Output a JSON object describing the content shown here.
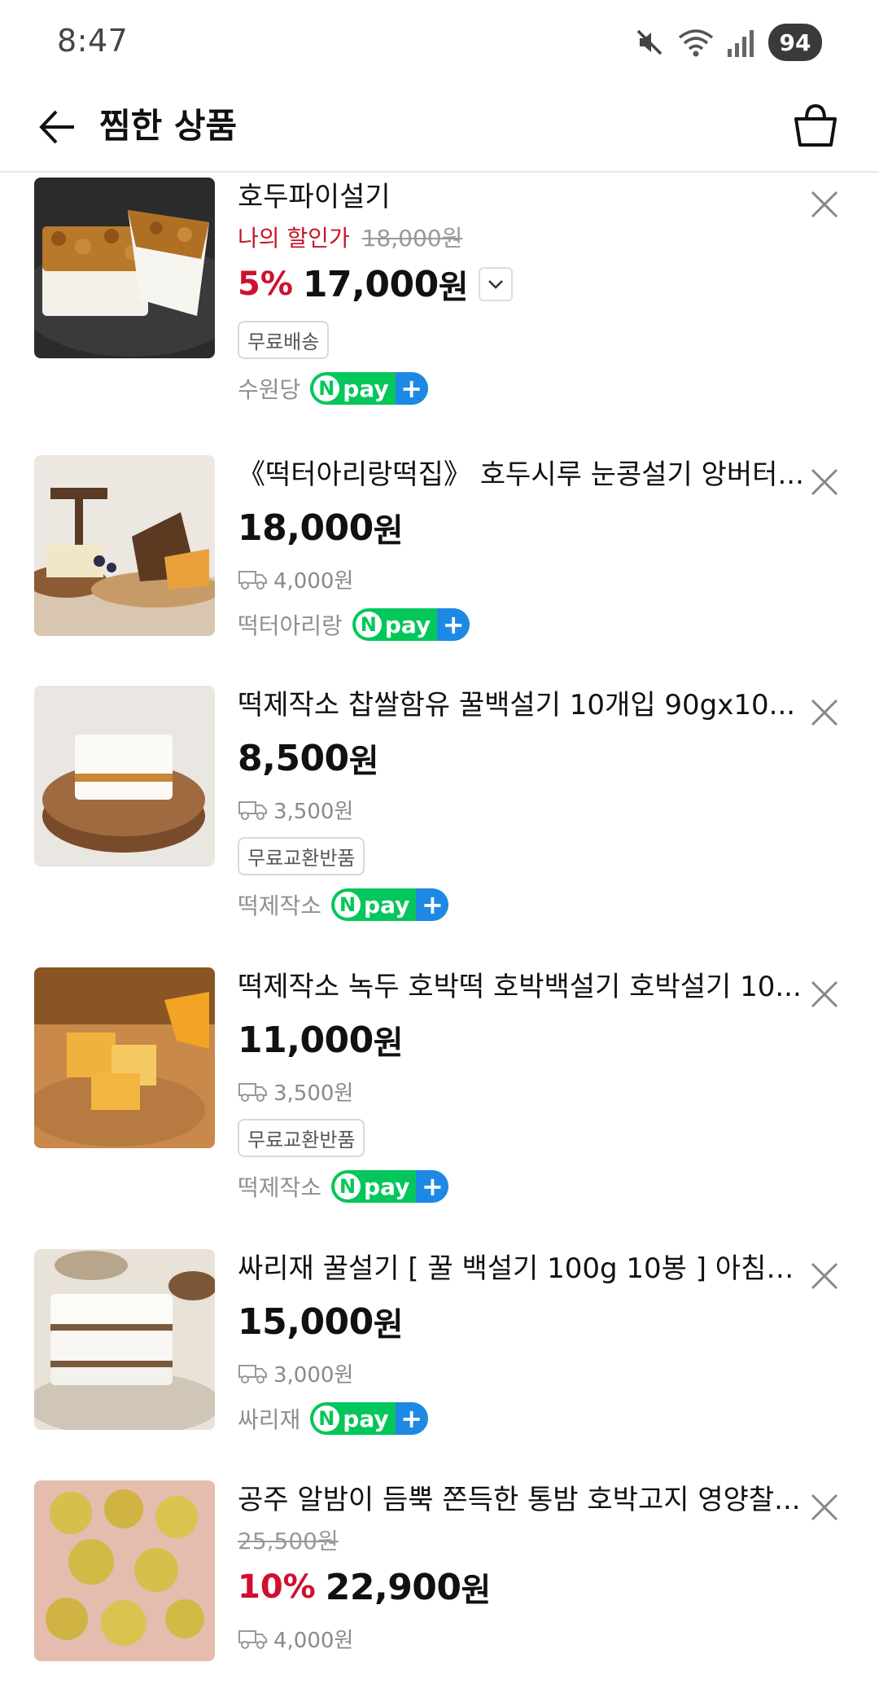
{
  "status": {
    "time": "8:47",
    "battery": "94"
  },
  "header": {
    "title": "찜한 상품"
  },
  "items": [
    {
      "name": "호두파이설기",
      "discount_label": "나의 할인가",
      "original_price": "18,000원",
      "rate": "5%",
      "price": "17,000",
      "unit": "원",
      "badge": "무료배송",
      "seller": "수원당"
    },
    {
      "name": "《떡터아리랑떡집》 호두시루 눈콩설기 앙버터...",
      "price": "18,000",
      "unit": "원",
      "shipping": "4,000원",
      "seller": "떡터아리랑"
    },
    {
      "name": "떡제작소 찹쌀함유 꿀백설기 10개입 90gx10...",
      "price": "8,500",
      "unit": "원",
      "shipping": "3,500원",
      "badge": "무료교환반품",
      "seller": "떡제작소"
    },
    {
      "name": "떡제작소 녹두 호박떡 호박백설기 호박설기 10...",
      "price": "11,000",
      "unit": "원",
      "shipping": "3,500원",
      "badge": "무료교환반품",
      "seller": "떡제작소"
    },
    {
      "name": "싸리재 꿀설기 [ 꿀 백설기 100g 10봉 ] 아침대...",
      "price": "15,000",
      "unit": "원",
      "shipping": "3,000원",
      "seller": "싸리재"
    },
    {
      "name": "공주 알밤이 듬뿍 쫀득한 통밤 호박고지 영양찰...",
      "original_price": "25,500원",
      "rate": "10%",
      "price": "22,900",
      "unit": "원",
      "shipping": "4,000원"
    }
  ],
  "npay": {
    "n": "N",
    "text": "pay",
    "plus": "+"
  },
  "colors": {
    "discount": "#d0102e",
    "npay_green": "#03c75a",
    "npay_blue": "#1e88e5"
  }
}
